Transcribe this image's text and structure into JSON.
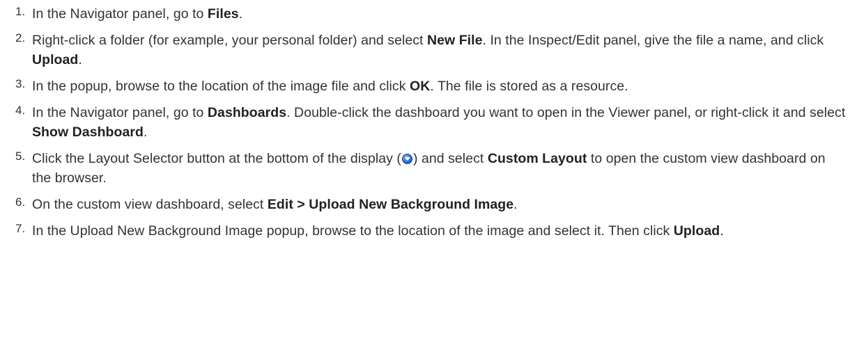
{
  "steps": [
    {
      "num": "1.",
      "a": "In the Navigator panel, go to ",
      "b1": "Files",
      "c": "."
    },
    {
      "num": "2.",
      "a": "Right-click a folder (for example, your personal folder) and select ",
      "b1": "New File",
      "c": ". In the Inspect/Edit panel, give the file a name, and click ",
      "b2": "Upload",
      "d": "."
    },
    {
      "num": "3.",
      "a": "In the popup, browse to the location of the image file and click ",
      "b1": "OK",
      "c": ". The file is stored as a resource."
    },
    {
      "num": "4.",
      "a": "In the Navigator panel, go to ",
      "b1": "Dashboards",
      "c": ". Double-click the dashboard you want to open in the Viewer panel, or right-click it and select ",
      "b2": "Show Dashboard",
      "d": "."
    },
    {
      "num": "5.",
      "a": "Click the Layout Selector button at the bottom of the display (",
      "icon": "layout-selector-icon",
      "c": ") and select ",
      "b1": "Custom Layout",
      "d": " to open the custom view dashboard on the browser."
    },
    {
      "num": "6.",
      "a": "On the custom view dashboard, select ",
      "b1": "Edit > Upload New Background Image",
      "c": "."
    },
    {
      "num": "7.",
      "a": "In the Upload New Background Image popup, browse to the location of the image and select it. Then click ",
      "b1": "Upload",
      "c": "."
    }
  ]
}
